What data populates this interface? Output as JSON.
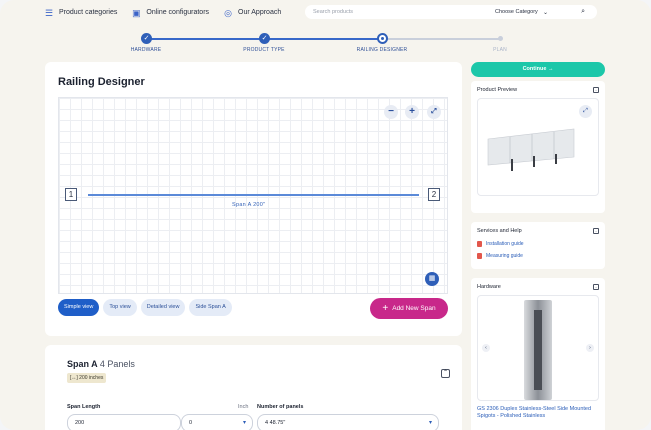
{
  "nav": {
    "items": [
      {
        "label": "Product categories",
        "icon": "menu-list-icon"
      },
      {
        "label": "Online configurators",
        "icon": "configurator-icon"
      },
      {
        "label": "Our Approach",
        "icon": "approach-icon"
      }
    ],
    "search_placeholder": "Search products",
    "category_select": "Choose Category"
  },
  "stepper": {
    "steps": [
      {
        "label": "HARDWARE",
        "state": "done"
      },
      {
        "label": "PRODUCT TYPE",
        "state": "done"
      },
      {
        "label": "RAILING DESIGNER",
        "state": "active"
      },
      {
        "label": "PLAN",
        "state": "todo"
      }
    ]
  },
  "designer": {
    "title": "Railing Designer",
    "span_start_label": "1",
    "span_end_label": "2",
    "span_label": "Span A 200\"",
    "views": [
      {
        "label": "Simple view",
        "active": true
      },
      {
        "label": "Top view",
        "active": false
      },
      {
        "label": "Detailed view",
        "active": false
      },
      {
        "label": "Side Span A",
        "active": false
      }
    ],
    "add_span_label": "Add New Span",
    "zoom_out": "−",
    "zoom_in": "+"
  },
  "span": {
    "name": "Span A",
    "panels_text": "4 Panels",
    "length_chip": "[↔] 200 inches",
    "span_length_label": "Span Length",
    "span_length_unit": "Inch",
    "span_length_value": "200",
    "span_length_fraction": "0",
    "number_of_panels_label": "Number of panels",
    "panels_value": "4",
    "panel_width": "48.75\""
  },
  "sidebar": {
    "continue_label": "Continue",
    "product_preview_title": "Product Preview",
    "services_title": "Services and Help",
    "guides": [
      "Installation guide",
      "Measuring guide"
    ],
    "hardware_title": "Hardware",
    "hardware_name": "GS 2306 Duplex Stainless-Steel Side Mounted Spigots - Polished Stainless"
  },
  "colors": {
    "primary": "#2f5fb8",
    "accent_continue": "#1cc7a9",
    "add_span": "#c8288a"
  }
}
